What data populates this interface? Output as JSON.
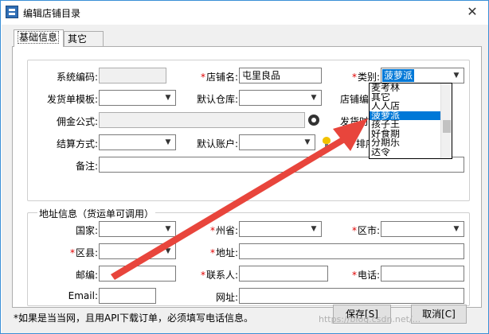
{
  "window": {
    "title": "编辑店铺目录",
    "close_glyph": "✕"
  },
  "tabs": [
    {
      "label": "基础信息"
    },
    {
      "label": "其它"
    }
  ],
  "basic": {
    "system_code_label": "系统编码:",
    "shop_name_label": "店铺名:",
    "shop_name_value": "屯里良品",
    "category_label": "类别:",
    "category_value": "菠萝派",
    "ship_template_label": "发货单模板:",
    "default_warehouse_label": "默认仓库:",
    "shop_no_label": "店铺编号",
    "commission_label": "佣金公式:",
    "ship_time_label": "发货时间",
    "settlement_label": "结算方式:",
    "default_account_label": "默认账户:",
    "sort_label": "排序:",
    "remark_label": "备注:"
  },
  "category_dropdown": {
    "items": [
      "麦考林",
      "其它",
      "人人店",
      "菠萝派",
      "孩子王",
      "好食期",
      "分期乐",
      "达令"
    ],
    "selected_index": 3
  },
  "address": {
    "legend": "地址信息（货运单可调用）",
    "country_label": "国家:",
    "province_label": "州省:",
    "city_label": "区市:",
    "district_label": "区县:",
    "address_label": "地址:",
    "postcode_label": "邮编:",
    "contact_label": "联系人:",
    "phone_label": "电话:",
    "email_label": "Email:",
    "website_label": "网址:"
  },
  "required_mark": "*",
  "footer": {
    "note": "*如果是当当网，且用API下载订单，必须填写电话信息。",
    "save_label": "保存[S]",
    "cancel_label": "取消[C]"
  },
  "watermark": "https://blog.csdn.net/..."
}
